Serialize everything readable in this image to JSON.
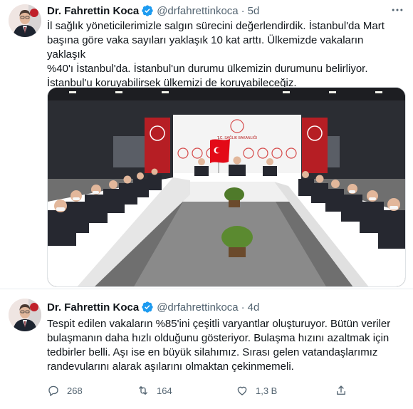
{
  "tweets": [
    {
      "author_name": "Dr. Fahrettin Koca",
      "handle": "@drfahrettinkoca",
      "separator": "·",
      "time": "5d",
      "text": "İl sağlık yöneticilerimizle salgın sürecini değerlendirdik. İstanbul'da Mart\nbaşına göre vaka sayıları yaklaşık 10 kat arttı. Ülkemizde vakaların yaklaşık\n%40'ı İstanbul'da. İstanbul'un durumu ülkemizin durumunu belirliyor.\nİstanbul'u koruyabilirsek ülkemizi de koruyabileceğiz.",
      "photo_banner_text": "T.C. SAĞLIK BAKANLIĞI"
    },
    {
      "author_name": "Dr. Fahrettin Koca",
      "handle": "@drfahrettinkoca",
      "separator": "·",
      "time": "4d",
      "text": "Tespit edilen vakaların %85'ini çeşitli varyantlar oluşturuyor. Bütün veriler\nbulaşmanın daha hızlı olduğunu gösteriyor. Bulaşma hızını azaltmak için\ntedbirler belli. Aşı ise en büyük silahımız. Sırası gelen vatandaşlarımız\nrandevularını alarak aşılarını olmaktan çekinmemeli.",
      "actions": {
        "reply_count": "268",
        "retweet_count": "164",
        "like_count": "1,3 B"
      }
    }
  ],
  "colors": {
    "verified": "#1d9bf0",
    "secondary_text": "#536471",
    "flag_red": "#e30a17"
  },
  "icons": [
    "verified-badge-icon",
    "more-options-icon",
    "reply-icon",
    "retweet-icon",
    "like-icon",
    "share-icon"
  ]
}
